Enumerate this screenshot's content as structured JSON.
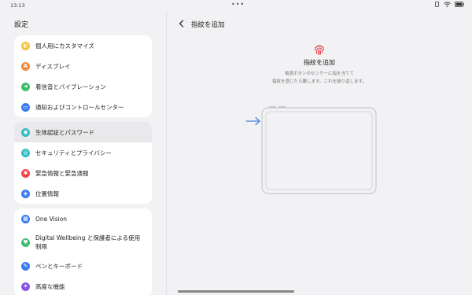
{
  "status_bar": {
    "time": "13:13",
    "dots": "•••"
  },
  "left_pane": {
    "title": "設定",
    "groups": [
      {
        "items": [
          {
            "label": "個人用にカスタマイズ",
            "icon": "palette-icon",
            "color": "#f5c242",
            "glyph": "◐"
          },
          {
            "label": "ディスプレイ",
            "icon": "display-icon",
            "color": "#f08a3c",
            "glyph": "A"
          },
          {
            "label": "着信音とバイブレーション",
            "icon": "speaker-icon",
            "color": "#3fbf6e",
            "glyph": "◀"
          },
          {
            "label": "通知およびコントロールセンター",
            "icon": "notification-icon",
            "color": "#3a7bf0",
            "glyph": "▭"
          }
        ]
      },
      {
        "items": [
          {
            "label": "生体認証とパスワード",
            "icon": "biometric-icon",
            "color": "#30bcc4",
            "glyph": "◉",
            "active": true
          },
          {
            "label": "セキュリティとプライバシー",
            "icon": "shield-icon",
            "color": "#30bcc4",
            "glyph": "◎"
          },
          {
            "label": "緊急情報と緊急通報",
            "icon": "emergency-icon",
            "color": "#f0474f",
            "glyph": "✱"
          },
          {
            "label": "位置情報",
            "icon": "location-icon",
            "color": "#3a7bf0",
            "glyph": "◈"
          }
        ]
      },
      {
        "items": [
          {
            "label": "One Vision",
            "icon": "one-vision-icon",
            "color": "#3a7bf0",
            "glyph": "▦"
          },
          {
            "label": "Digital Wellbeing と保護者による使用制限",
            "icon": "wellbeing-icon",
            "color": "#3fbf6e",
            "glyph": "♥"
          },
          {
            "label": "ペンとキーボード",
            "icon": "pen-icon",
            "color": "#3a7bf0",
            "glyph": "✎"
          },
          {
            "label": "高度な機能",
            "icon": "advanced-icon",
            "color": "#8a55e0",
            "glyph": "✦"
          }
        ]
      }
    ]
  },
  "right_pane": {
    "title": "指紋を追加",
    "heading": "指紋を追加",
    "description_line1": "電源ボタンのセンサーに指を当てて",
    "description_line2": "指紋を感じたら離します。これを繰り返します。",
    "accent_color": "#e0444f",
    "guide_arrow_color": "#4a7fd8"
  }
}
